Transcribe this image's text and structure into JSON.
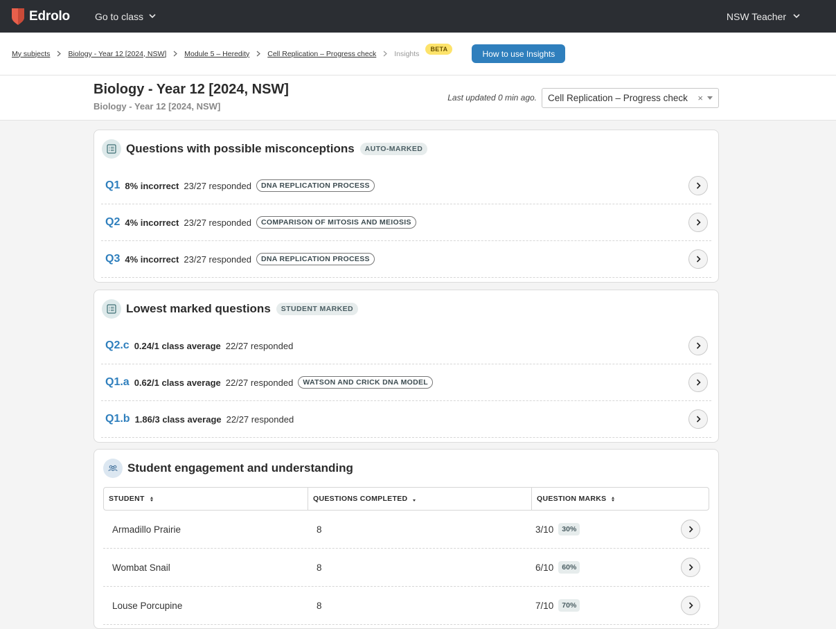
{
  "nav": {
    "brand": "Edrolo",
    "goto_label": "Go to class",
    "user_label": "NSW Teacher"
  },
  "breadcrumb": {
    "items": [
      "My subjects",
      "Biology - Year 12 [2024, NSW]",
      "Module 5 – Heredity",
      "Cell Replication – Progress check"
    ],
    "current": "Insights",
    "beta": "BETA",
    "howto": "How to use Insights"
  },
  "header": {
    "title": "Biology - Year 12 [2024, NSW]",
    "subtitle": "Biology - Year 12 [2024, NSW]",
    "updated": "Last updated 0 min ago.",
    "select_value": "Cell Replication – Progress check",
    "clear": "×"
  },
  "misconceptions": {
    "title": "Questions with possible misconceptions",
    "badge": "AUTO-MARKED",
    "rows": [
      {
        "q": "Q1",
        "stat": "8% incorrect",
        "resp": "23/27 responded",
        "topic": "DNA REPLICATION PROCESS"
      },
      {
        "q": "Q2",
        "stat": "4% incorrect",
        "resp": "23/27 responded",
        "topic": "COMPARISON OF MITOSIS AND MEIOSIS"
      },
      {
        "q": "Q3",
        "stat": "4% incorrect",
        "resp": "23/27 responded",
        "topic": "DNA REPLICATION PROCESS"
      }
    ]
  },
  "lowest": {
    "title": "Lowest marked questions",
    "badge": "STUDENT MARKED",
    "rows": [
      {
        "q": "Q2.c",
        "stat": "0.24/1 class average",
        "resp": "22/27 responded"
      },
      {
        "q": "Q1.a",
        "stat": "0.62/1 class average",
        "resp": "22/27 responded",
        "topic": "WATSON AND CRICK DNA MODEL"
      },
      {
        "q": "Q1.b",
        "stat": "1.86/3 class average",
        "resp": "22/27 responded"
      }
    ]
  },
  "engagement": {
    "title": "Student engagement and understanding",
    "columns": [
      "STUDENT",
      "QUESTIONS COMPLETED",
      "QUESTION MARKS"
    ],
    "rows": [
      {
        "name": "Armadillo Prairie",
        "completed": "8",
        "marks": "3/10",
        "pct": "30%"
      },
      {
        "name": "Wombat Snail",
        "completed": "8",
        "marks": "6/10",
        "pct": "60%"
      },
      {
        "name": "Louse Porcupine",
        "completed": "8",
        "marks": "7/10",
        "pct": "70%"
      }
    ]
  },
  "colors": {
    "nav_bg": "#2b2e33",
    "accent": "#2f7fbd",
    "logo": "#e8604c",
    "beta_bg": "#fde36b"
  }
}
